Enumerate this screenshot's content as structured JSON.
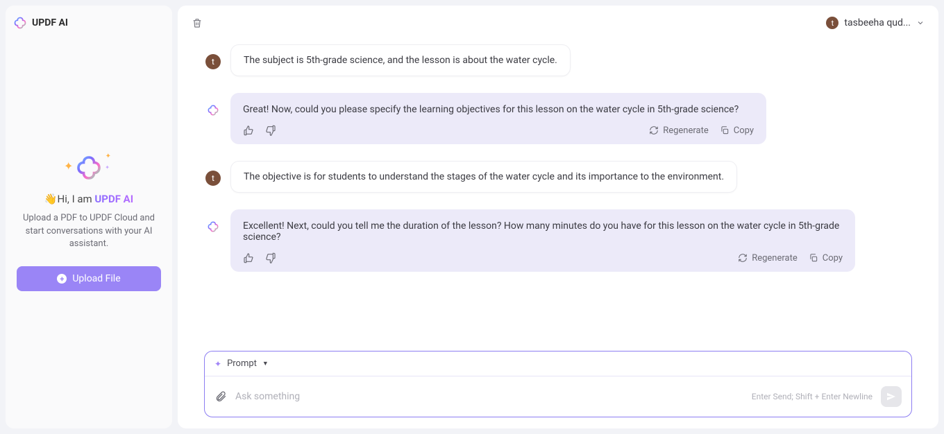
{
  "brand_name": "UPDF AI",
  "sidebar": {
    "hello_prefix": "Hi, I am ",
    "hello_brand": "UPDF AI",
    "description": "Upload a PDF to UPDF Cloud and start conversations with your AI assistant.",
    "upload_label": "Upload File",
    "wave_emoji": "👋"
  },
  "header": {
    "user_initial": "t",
    "user_name": "tasbeeha qud..."
  },
  "messages": {
    "m1": {
      "role": "user",
      "initial": "t",
      "text": "The subject is 5th-grade science, and the lesson is about the water cycle."
    },
    "m2": {
      "role": "assistant",
      "text": "Great! Now, could you please specify the learning objectives for this lesson on the water cycle in 5th-grade science?"
    },
    "m3": {
      "role": "user",
      "initial": "t",
      "text": "The objective is for students to understand the stages of the water cycle and its importance to the environment."
    },
    "m4": {
      "role": "assistant",
      "text": "Excellent! Next, could you tell me the duration of the lesson? How many minutes do you have for this lesson on the water cycle in 5th-grade science?"
    }
  },
  "actions": {
    "regenerate": "Regenerate",
    "copy": "Copy"
  },
  "input": {
    "prompt_label": "Prompt",
    "placeholder": "Ask something",
    "hint": "Enter Send; Shift + Enter Newline"
  }
}
